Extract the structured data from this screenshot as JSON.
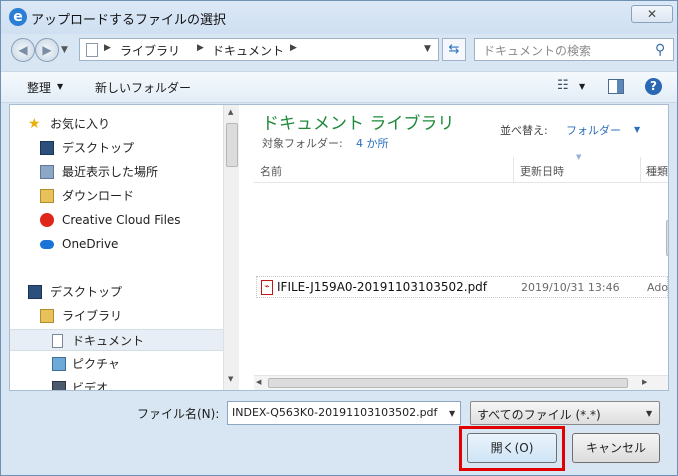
{
  "window": {
    "title": "アップロードするファイルの選択",
    "close_glyph": "✕"
  },
  "address_bar": {
    "crumbs": [
      "ライブラリ",
      "ドキュメント"
    ],
    "search_placeholder": "ドキュメントの検索"
  },
  "toolbar": {
    "organize_label": "整理",
    "new_folder_label": "新しいフォルダー"
  },
  "nav_pane": {
    "items": [
      {
        "label": "お気に入り",
        "icon": "star-icon"
      },
      {
        "label": "デスクトップ",
        "icon": "desktop-icon"
      },
      {
        "label": "最近表示した場所",
        "icon": "recent-places-icon"
      },
      {
        "label": "ダウンロード",
        "icon": "download-folder-icon"
      },
      {
        "label": "Creative Cloud Files",
        "icon": "creative-cloud-icon"
      },
      {
        "label": "OneDrive",
        "icon": "onedrive-cloud-icon"
      },
      {
        "label": "デスクトップ",
        "icon": "desktop-icon"
      },
      {
        "label": "ライブラリ",
        "icon": "library-folder-icon"
      },
      {
        "label": "ドキュメント",
        "icon": "document-icon",
        "selected": true
      },
      {
        "label": "ピクチャ",
        "icon": "picture-icon"
      },
      {
        "label": "ビデオ",
        "icon": "video-icon"
      }
    ]
  },
  "library": {
    "title": "ドキュメント ライブラリ",
    "subtitle_label": "対象フォルダー:",
    "subtitle_value": "4 か所",
    "arrange_label": "並べ替え:",
    "arrange_value": "フォルダー"
  },
  "columns": {
    "name": "名前",
    "date": "更新日時",
    "type": "種類"
  },
  "files": [
    {
      "name": "IFILE-J159A0-20191103103502.pdf",
      "date": "2019/10/31 13:46",
      "type": "Ado"
    }
  ],
  "bottom": {
    "filename_label": "ファイル名(N):",
    "filename_value": "INDEX-Q563K0-20191103103502.pdf",
    "filetype_value": "すべてのファイル (*.*)",
    "open_label": "開く(O)",
    "cancel_label": "キャンセル"
  },
  "colors": {
    "library_title": "#1f8a3a",
    "link_blue": "#2a6fbd",
    "highlight_outline": "#e20000"
  }
}
